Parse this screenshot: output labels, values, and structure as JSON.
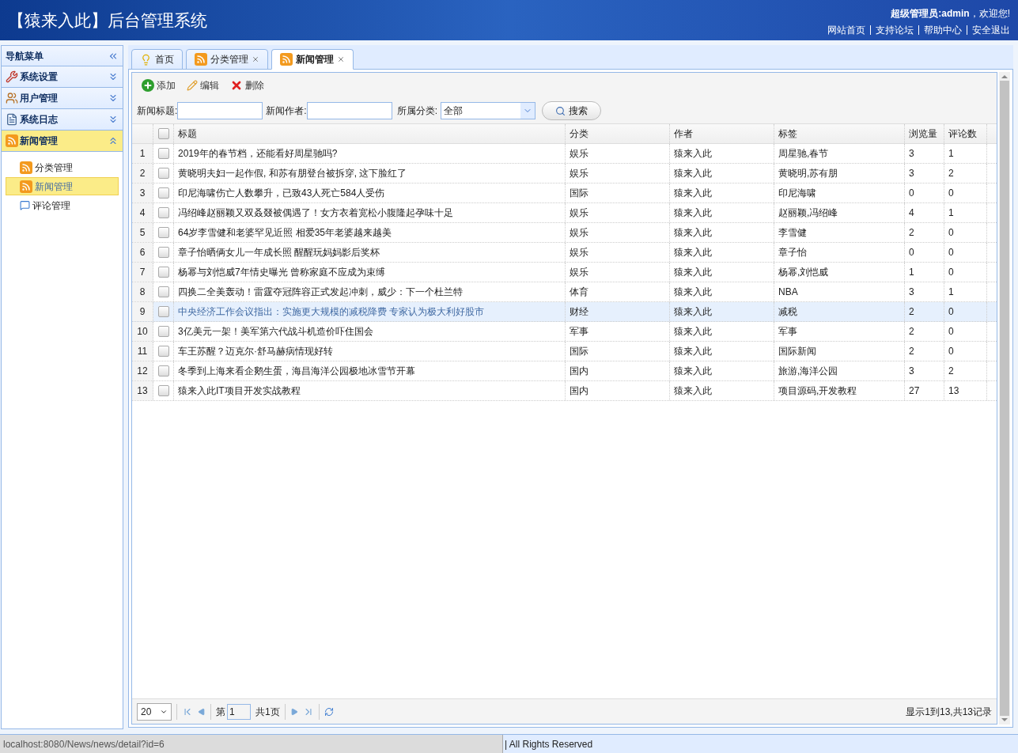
{
  "header": {
    "title": "【猿来入此】后台管理系统",
    "greeting_user": "超级管理员:admin",
    "greeting_text": "，欢迎您!",
    "links": [
      "网站首页",
      "支持论坛",
      "帮助中心",
      "安全退出"
    ]
  },
  "sidebar": {
    "title": "导航菜单",
    "groups": [
      {
        "label": "系统设置",
        "expanded": false
      },
      {
        "label": "用户管理",
        "expanded": false
      },
      {
        "label": "系统日志",
        "expanded": false
      },
      {
        "label": "新闻管理",
        "expanded": true,
        "items": [
          {
            "label": "分类管理",
            "selected": false
          },
          {
            "label": "新闻管理",
            "selected": true
          },
          {
            "label": "评论管理",
            "selected": false
          }
        ]
      }
    ]
  },
  "tabs": [
    {
      "label": "首页",
      "closable": false,
      "selected": false
    },
    {
      "label": "分类管理",
      "closable": true,
      "selected": false
    },
    {
      "label": "新闻管理",
      "closable": true,
      "selected": true
    }
  ],
  "toolbar": [
    {
      "label": "添加",
      "kind": "add"
    },
    {
      "label": "编辑",
      "kind": "edit"
    },
    {
      "label": "删除",
      "kind": "delete"
    }
  ],
  "search": {
    "title_label": "新闻标题:",
    "author_label": "新闻作者:",
    "category_label": "所属分类:",
    "category_value": "全部",
    "button": "搜索"
  },
  "table": {
    "header_checked": false,
    "columns": [
      "标题",
      "分类",
      "作者",
      "标签",
      "浏览量",
      "评论数"
    ],
    "rows": [
      {
        "num": "1",
        "checked": false,
        "hovered": false,
        "cells": [
          "2019年的春节档，还能看好周星驰吗?",
          "娱乐",
          "猿来入此",
          "周星驰,春节",
          "3",
          "1"
        ]
      },
      {
        "num": "2",
        "checked": false,
        "hovered": false,
        "cells": [
          "黄晓明夫妇一起作假, 和苏有朋登台被拆穿, 这下脸红了",
          "娱乐",
          "猿来入此",
          "黄晓明,苏有朋",
          "3",
          "2"
        ]
      },
      {
        "num": "3",
        "checked": false,
        "hovered": false,
        "cells": [
          "印尼海啸伤亡人数攀升，已致43人死亡584人受伤",
          "国际",
          "猿来入此",
          "印尼海啸",
          "0",
          "0"
        ]
      },
      {
        "num": "4",
        "checked": false,
        "hovered": false,
        "cells": [
          "冯绍峰赵丽颖又双叒叕被偶遇了！女方衣着宽松小腹隆起孕味十足",
          "娱乐",
          "猿来入此",
          "赵丽颖,冯绍峰",
          "4",
          "1"
        ]
      },
      {
        "num": "5",
        "checked": false,
        "hovered": false,
        "cells": [
          "64岁李雪健和老婆罕见近照 相爱35年老婆越来越美",
          "娱乐",
          "猿来入此",
          "李雪健",
          "2",
          "0"
        ]
      },
      {
        "num": "6",
        "checked": false,
        "hovered": false,
        "cells": [
          "章子怡晒俩女儿一年成长照 醒醒玩妈妈影后奖杯",
          "娱乐",
          "猿来入此",
          "章子怡",
          "0",
          "0"
        ]
      },
      {
        "num": "7",
        "checked": false,
        "hovered": false,
        "cells": [
          "杨幂与刘恺威7年情史曝光 曾称家庭不应成为束缚",
          "娱乐",
          "猿来入此",
          "杨幂,刘恺威",
          "1",
          "0"
        ]
      },
      {
        "num": "8",
        "checked": false,
        "hovered": false,
        "cells": [
          "四换二全美轰动！雷霆夺冠阵容正式发起冲刺，威少：下一个杜兰特",
          "体育",
          "猿来入此",
          "NBA",
          "3",
          "1"
        ]
      },
      {
        "num": "9",
        "checked": false,
        "hovered": true,
        "cells": [
          "中央经济工作会议指出：实施更大规模的减税降费 专家认为极大利好股市",
          "财经",
          "猿来入此",
          "减税",
          "2",
          "0"
        ]
      },
      {
        "num": "10",
        "checked": false,
        "hovered": false,
        "cells": [
          "3亿美元一架！美军第六代战斗机造价吓住国会",
          "军事",
          "猿来入此",
          "军事",
          "2",
          "0"
        ]
      },
      {
        "num": "11",
        "checked": false,
        "hovered": false,
        "cells": [
          "车王苏醒？迈克尔·舒马赫病情现好转",
          "国际",
          "猿来入此",
          "国际新闻",
          "2",
          "0"
        ]
      },
      {
        "num": "12",
        "checked": false,
        "hovered": false,
        "cells": [
          "冬季到上海来看企鹅生蛋，海昌海洋公园极地冰雪节开幕",
          "国内",
          "猿来入此",
          "旅游,海洋公园",
          "3",
          "2"
        ]
      },
      {
        "num": "13",
        "checked": false,
        "hovered": false,
        "cells": [
          "猿来入此IT项目开发实战教程",
          "国内",
          "猿来入此",
          "项目源码,开发教程",
          "27",
          "13"
        ]
      }
    ]
  },
  "pager": {
    "page_size": "20",
    "page_prefix": "第",
    "page": "1",
    "page_suffix": "共1页",
    "summary": "显示1到13,共13记录"
  },
  "status_url": "localhost:8080/News/news/detail?id=6",
  "footer": "| All Rights Reserved"
}
